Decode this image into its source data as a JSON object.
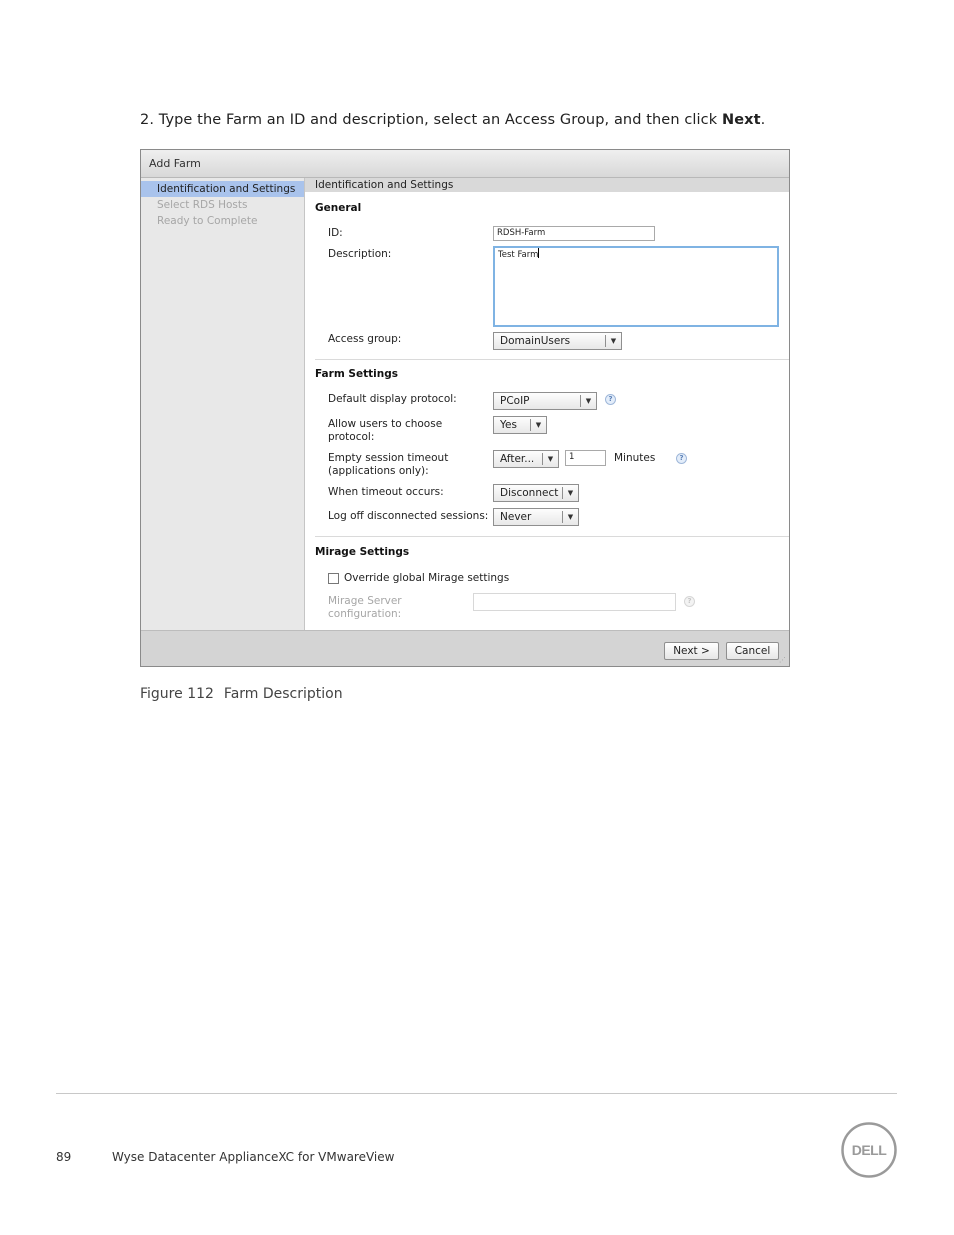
{
  "instruction": {
    "prefix": "2. Type the Farm an ID and description, select an Access Group, and then click ",
    "bold": "Next",
    "suffix": "."
  },
  "dialog": {
    "title": "Add Farm",
    "nav": [
      {
        "label": "Identification and Settings",
        "state": "active"
      },
      {
        "label": "Select RDS Hosts",
        "state": "disabled"
      },
      {
        "label": "Ready to Complete",
        "state": "disabled"
      }
    ],
    "section_header": "Identification and Settings",
    "general": {
      "title": "General",
      "id_label": "ID:",
      "id_value": "RDSH-Farm",
      "description_label": "Description:",
      "description_value": "Test Farm",
      "access_group_label": "Access group:",
      "access_group_value": "DomainUsers"
    },
    "farm_settings": {
      "title": "Farm Settings",
      "protocol_label": "Default display protocol:",
      "protocol_value": "PCoIP",
      "allow_choose_label_1": "Allow users to choose",
      "allow_choose_label_2": "protocol:",
      "allow_choose_value": "Yes",
      "timeout_label_1": "Empty session timeout",
      "timeout_label_2": "(applications only):",
      "timeout_mode": "After...",
      "timeout_value": "1",
      "timeout_unit": "Minutes",
      "when_timeout_label": "When timeout occurs:",
      "when_timeout_value": "Disconnect",
      "logoff_label": "Log off disconnected sessions:",
      "logoff_value": "Never"
    },
    "mirage": {
      "title": "Mirage Settings",
      "override_label": "Override global Mirage settings",
      "override_checked": false,
      "server_label_1": "Mirage Server",
      "server_label_2": "configuration:",
      "server_value": ""
    },
    "buttons": {
      "next": "Next >",
      "cancel": "Cancel"
    },
    "help_glyph": "?",
    "dropdown_glyph": "▼"
  },
  "caption": {
    "number": "Figure 112",
    "text": "Farm Description"
  },
  "footer": {
    "page_number": "89",
    "doc_title": "Wyse Datacenter ApplianceXC for VMwareView"
  },
  "logo": {
    "name": "dell-logo",
    "text": "DELL",
    "color": "#9a9a9a"
  }
}
